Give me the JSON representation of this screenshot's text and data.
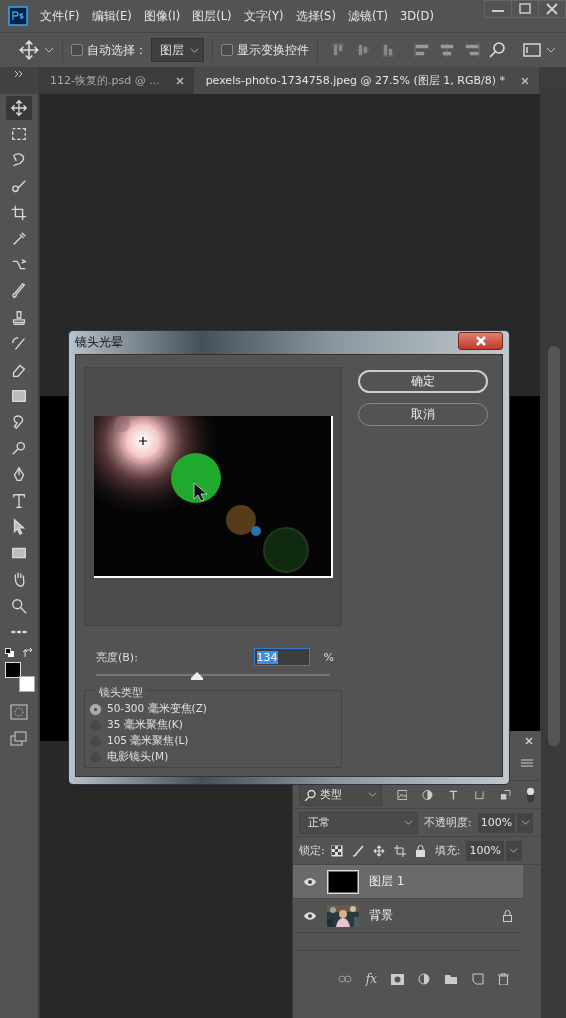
{
  "menu": [
    "文件(F)",
    "编辑(E)",
    "图像(I)",
    "图层(L)",
    "文字(Y)",
    "选择(S)",
    "滤镜(T)",
    "3D(D)"
  ],
  "options_bar": {
    "auto_select": {
      "label": "自动选择：",
      "checked": false
    },
    "auto_select_target": "图层",
    "show_transform": {
      "label": "显示变换控件",
      "checked": false
    }
  },
  "tabs": [
    {
      "label": "112-恢复的.psd @ ...",
      "selected": false
    },
    {
      "label": "pexels-photo-1734758.jpeg @ 27.5% (图层 1, RGB/8) *",
      "selected": true
    }
  ],
  "tools": [
    {
      "kind": "move",
      "selected": true
    },
    {
      "kind": "marquee",
      "selected": false
    },
    {
      "kind": "lasso",
      "selected": false
    },
    {
      "kind": "quick-select",
      "selected": false
    },
    {
      "kind": "crop",
      "selected": false
    },
    {
      "kind": "eyedropper",
      "selected": false
    },
    {
      "kind": "healing",
      "selected": false
    },
    {
      "kind": "brush",
      "selected": false
    },
    {
      "kind": "stamp",
      "selected": false
    },
    {
      "kind": "history-brush",
      "selected": false
    },
    {
      "kind": "eraser",
      "selected": false
    },
    {
      "kind": "gradient",
      "selected": false
    },
    {
      "kind": "blur",
      "selected": false
    },
    {
      "kind": "dodge",
      "selected": false
    },
    {
      "kind": "pen",
      "selected": false
    },
    {
      "kind": "type",
      "selected": false
    },
    {
      "kind": "path-select",
      "selected": false
    },
    {
      "kind": "shape",
      "selected": false
    },
    {
      "kind": "hand",
      "selected": false
    },
    {
      "kind": "zoom",
      "selected": false
    },
    {
      "kind": "more",
      "selected": false
    }
  ],
  "dialog": {
    "title": "镜头光晕",
    "buttons": [
      {
        "label": "确定",
        "default": true
      },
      {
        "label": "取消",
        "default": false
      }
    ],
    "brightness": {
      "label": "亮度(B):",
      "value": "134",
      "unit": "%",
      "level": 0.43
    },
    "lens_type": {
      "legend": "镜头类型",
      "options": [
        {
          "label": "50-300 毫米变焦(Z)",
          "selected": true
        },
        {
          "label": "35 毫米聚焦(K)",
          "selected": false
        },
        {
          "label": "105 毫米聚焦(L)",
          "selected": false
        },
        {
          "label": "电影镜头(M)",
          "selected": false
        }
      ]
    }
  },
  "layers_panel": {
    "filter": "类型",
    "blend_mode": "正常",
    "opacity_label": "不透明度:",
    "opacity": "100%",
    "lock_label": "锁定:",
    "fill_label": "填充:",
    "fill": "100%",
    "fx": "fx",
    "layers": [
      {
        "name": "图层 1",
        "kind": "fill",
        "selected": true,
        "visible": true,
        "locked": false
      },
      {
        "name": "背景",
        "kind": "picture",
        "selected": false,
        "visible": true,
        "locked": true
      }
    ]
  }
}
